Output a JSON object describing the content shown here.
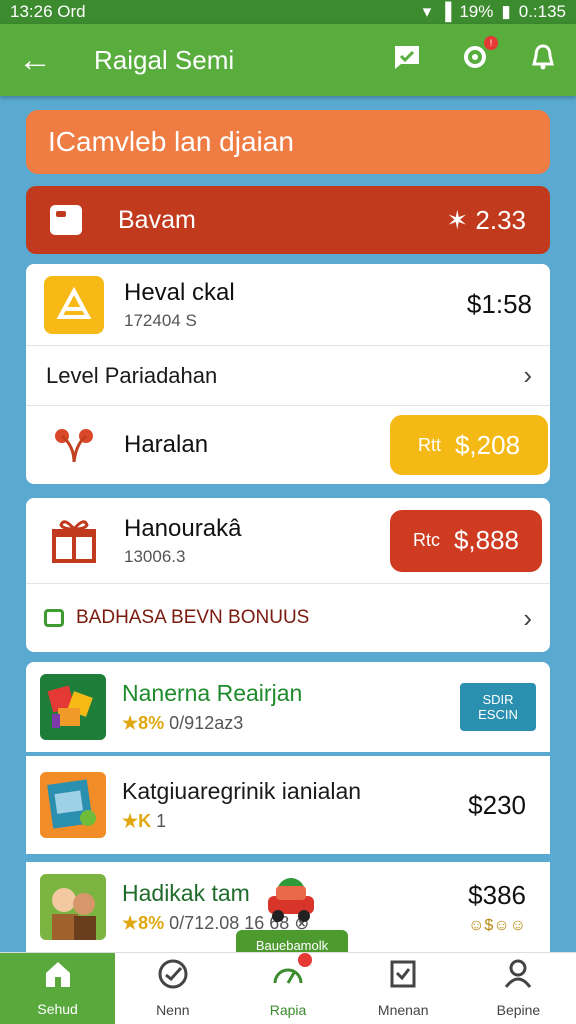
{
  "status_bar": {
    "time": "13:26 Ord",
    "battery": "19%",
    "right_time": "0.:135"
  },
  "app_bar": {
    "title": "Raigal Semi",
    "notification_badge": "!"
  },
  "banner_orange": {
    "text": "ICamvleb lan djaian"
  },
  "banner_red": {
    "label": "Bavam",
    "value": "✶ 2.33"
  },
  "card_one": {
    "row_main": {
      "name": "Heval ckal",
      "sub": "172404 S",
      "amount": "$1:58"
    },
    "row_level": {
      "label": "Level Pariadahan"
    },
    "row_haralan": {
      "name": "Haralan",
      "pill_prefix": "Rtt",
      "pill_value": "$,208",
      "pill_color": "#f5b916"
    }
  },
  "card_two": {
    "row_main": {
      "name": "Hanourakâ",
      "sub": "13006.3",
      "pill_prefix": "Rtc",
      "pill_value": "$,888",
      "pill_color": "#cf3b20"
    },
    "row_bonus": {
      "label": "BADHASA BEVN BONUUS"
    }
  },
  "apps": [
    {
      "name": "Nanerna Reairjan",
      "pct": "★8%",
      "rest": "0/912az3",
      "button": "SDIR ESCIN",
      "name_color": "#1f8a2c"
    },
    {
      "name": "Katgiuaregrinik ianialan",
      "pct": "★K",
      "rest": "1",
      "amount": "$230",
      "name_color": "#111111"
    },
    {
      "name": "Hadikak tam",
      "pct": "★8%",
      "rest": "0/712.08 16 68 ⊗",
      "amount": "$386",
      "mini": "☺$☺☺",
      "name_color": "#1f6b2a"
    }
  ],
  "fab": {
    "label": "Bauebamolk"
  },
  "bottom_nav": [
    {
      "label": "Sehud",
      "icon": "home-icon"
    },
    {
      "label": "Nenn",
      "icon": "check-circle-icon"
    },
    {
      "label": "Rapia",
      "icon": "speedometer-icon"
    },
    {
      "label": "Mnenan",
      "icon": "clipboard-icon"
    },
    {
      "label": "Bepine",
      "icon": "person-icon"
    }
  ]
}
